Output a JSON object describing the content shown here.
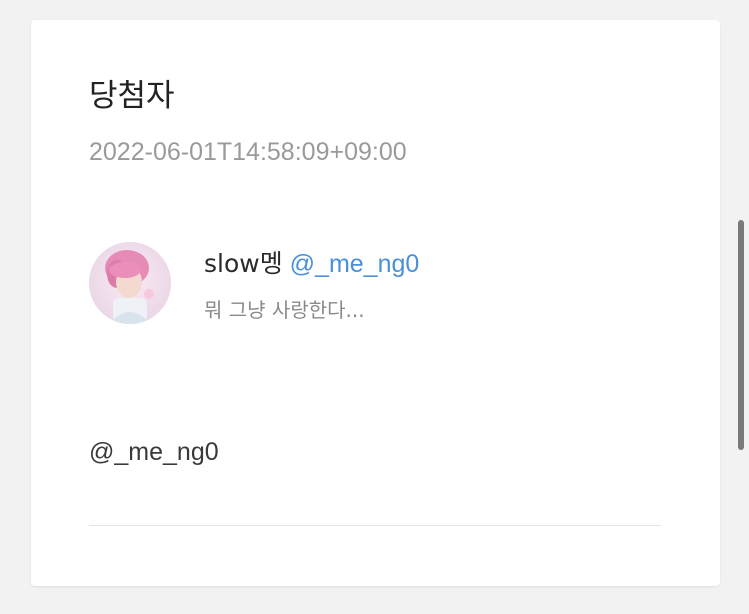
{
  "card": {
    "title": "당첨자",
    "timestamp": "2022-06-01T14:58:09+09:00",
    "user": {
      "display_name": "slow멩",
      "handle": "@_me_ng0",
      "bio": "뭐 그냥 사랑한다..."
    },
    "mention": "@_me_ng0"
  },
  "colors": {
    "background": "#f2f2f2",
    "card": "#ffffff",
    "handle_link": "#4a90d9",
    "muted_text": "#9a9a9a"
  }
}
